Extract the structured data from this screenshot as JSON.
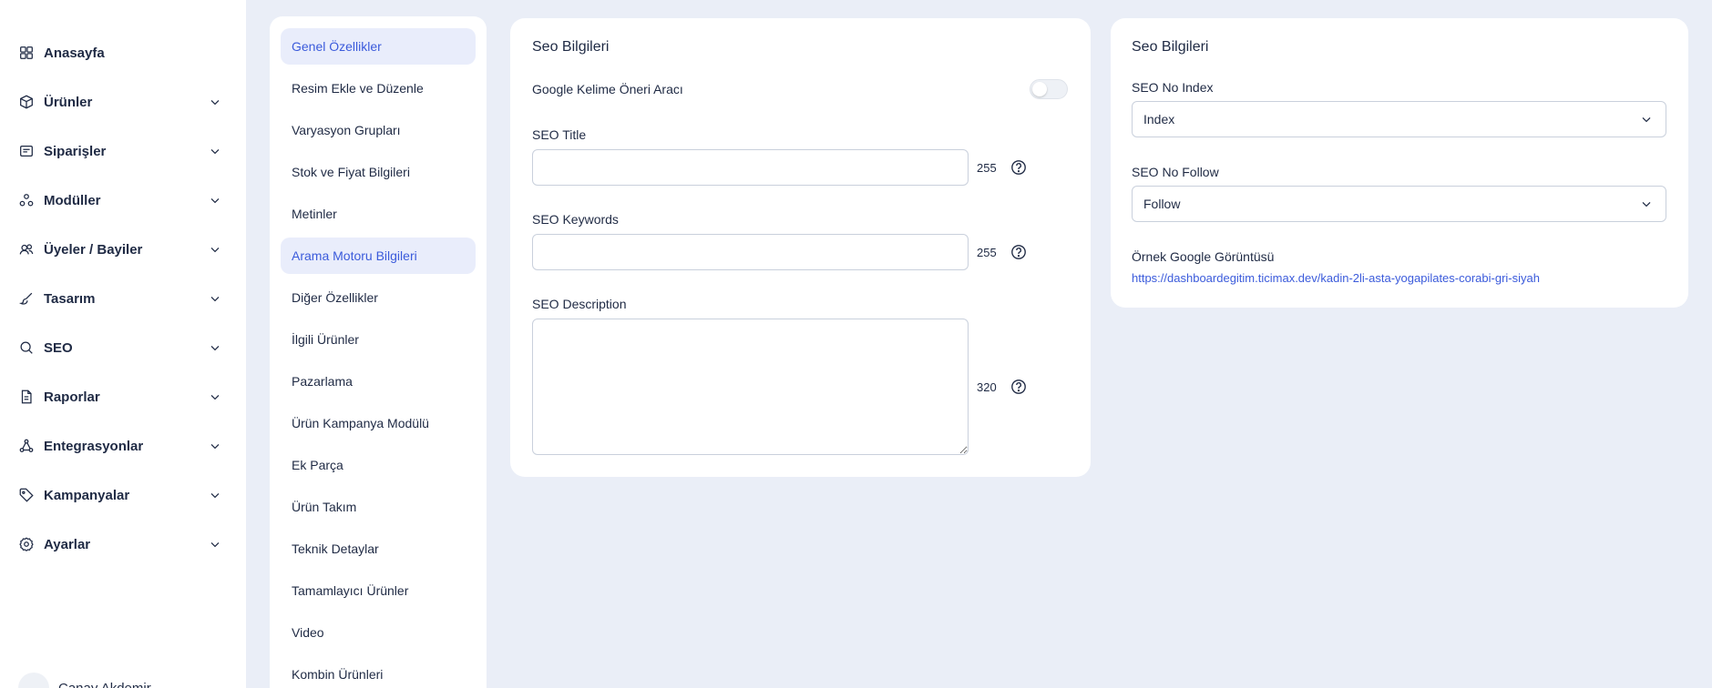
{
  "sidebar": {
    "items": [
      {
        "label": "Anasayfa",
        "icon": "grid-icon",
        "has_chevron": false
      },
      {
        "label": "Ürünler",
        "icon": "box-icon",
        "has_chevron": true
      },
      {
        "label": "Siparişler",
        "icon": "orders-icon",
        "has_chevron": true
      },
      {
        "label": "Modüller",
        "icon": "modules-icon",
        "has_chevron": true
      },
      {
        "label": "Üyeler / Bayiler",
        "icon": "users-icon",
        "has_chevron": true
      },
      {
        "label": "Tasarım",
        "icon": "brush-icon",
        "has_chevron": true
      },
      {
        "label": "SEO",
        "icon": "search-icon",
        "has_chevron": true
      },
      {
        "label": "Raporlar",
        "icon": "report-icon",
        "has_chevron": true
      },
      {
        "label": "Entegrasyonlar",
        "icon": "integration-icon",
        "has_chevron": true
      },
      {
        "label": "Kampanyalar",
        "icon": "tag-icon",
        "has_chevron": true
      },
      {
        "label": "Ayarlar",
        "icon": "gear-icon",
        "has_chevron": true
      }
    ],
    "user_name": "Canay Akdemir"
  },
  "menu": {
    "items": [
      {
        "label": "Genel Özellikler",
        "active": true
      },
      {
        "label": "Resim Ekle ve Düzenle",
        "active": false
      },
      {
        "label": "Varyasyon Grupları",
        "active": false
      },
      {
        "label": "Stok ve Fiyat Bilgileri",
        "active": false
      },
      {
        "label": "Metinler",
        "active": false
      },
      {
        "label": "Arama Motoru Bilgileri",
        "active": true
      },
      {
        "label": "Diğer Özellikler",
        "active": false
      },
      {
        "label": "İlgili Ürünler",
        "active": false
      },
      {
        "label": "Pazarlama",
        "active": false
      },
      {
        "label": "Ürün Kampanya Modülü",
        "active": false
      },
      {
        "label": "Ek Parça",
        "active": false
      },
      {
        "label": "Ürün Takım",
        "active": false
      },
      {
        "label": "Teknik Detaylar",
        "active": false
      },
      {
        "label": "Tamamlayıcı Ürünler",
        "active": false
      },
      {
        "label": "Video",
        "active": false
      },
      {
        "label": "Kombin Ürünleri",
        "active": false
      }
    ]
  },
  "seo_form": {
    "title": "Seo Bilgileri",
    "google_tool_label": "Google Kelime Öneri Aracı",
    "google_tool_enabled": false,
    "seo_title_label": "SEO Title",
    "seo_title_value": "",
    "seo_title_count": "255",
    "seo_keywords_label": "SEO Keywords",
    "seo_keywords_value": "",
    "seo_keywords_count": "255",
    "seo_description_label": "SEO Description",
    "seo_description_value": "",
    "seo_description_count": "320"
  },
  "seo_options": {
    "title": "Seo Bilgileri",
    "no_index_label": "SEO No Index",
    "no_index_value": "Index",
    "no_follow_label": "SEO No Follow",
    "no_follow_value": "Follow",
    "preview_label": "Örnek Google Görüntüsü",
    "preview_url": "https://dashboardegitim.ticimax.dev/kadin-2li-asta-yogapilates-corabi-gri-siyah"
  },
  "colors": {
    "accent": "#3b5bdb",
    "active_bg": "#e9edfb",
    "page_bg": "#eaeef7"
  }
}
